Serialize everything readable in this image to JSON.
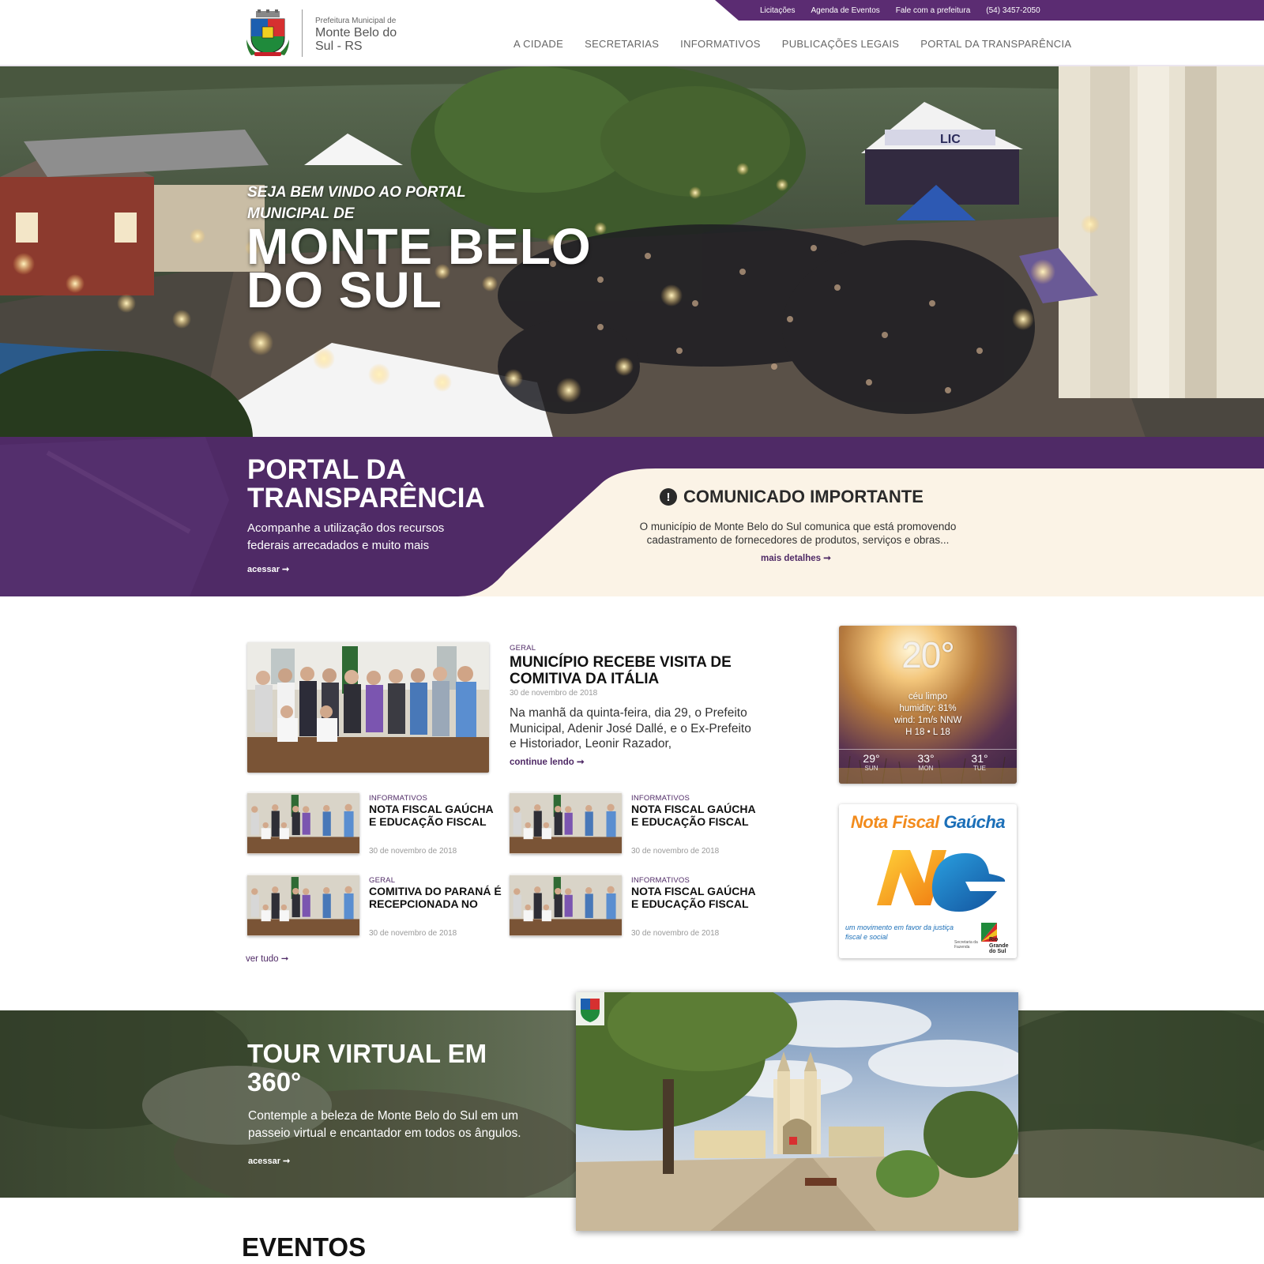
{
  "header": {
    "top_links": [
      "Licitações",
      "Agenda de Eventos",
      "Fale com a prefeitura",
      "(54) 3457-2050"
    ],
    "brand_small": "Prefeitura Municipal de",
    "brand_big": "Monte Belo do Sul - RS",
    "nav": [
      "A CIDADE",
      "SECRETARIAS",
      "INFORMATIVOS",
      "PUBLICAÇÕES LEGAIS",
      "PORTAL DA TRANSPARÊNCIA"
    ]
  },
  "hero": {
    "welcome": "SEJA BEM VINDO AO PORTAL MUNICIPAL DE",
    "city": "MONTE BELO DO SUL",
    "stage_sign": "LIC"
  },
  "transparency": {
    "title": "PORTAL DA TRANSPARÊNCIA",
    "description": "Acompanhe a utilização dos recursos federais arrecadados e muito mais",
    "link": "acessar ➞"
  },
  "notice": {
    "icon": "!",
    "title": "COMUNICADO IMPORTANTE",
    "text": "O município de Monte Belo do Sul comunica que está promovendo cadastramento de fornecedores de produtos, serviços e obras...",
    "link": "mais detalhes ➞"
  },
  "news": {
    "featured": {
      "category": "GERAL",
      "title": "MUNICÍPIO RECEBE VISITA DE COMITIVA DA ITÁLIA",
      "date": "30 de novembro de 2018",
      "excerpt": "Na manhã da quinta-feira, dia 29, o Prefeito Municipal, Adenir José Dallé, e o Ex-Prefeito e Historiador, Leonir Razador,",
      "link": "continue lendo ➞"
    },
    "items": [
      {
        "category": "INFORMATIVOS",
        "title": "NOTA FISCAL GAÚCHA E EDUCAÇÃO FISCAL",
        "date": "30 de novembro de 2018"
      },
      {
        "category": "INFORMATIVOS",
        "title": "NOTA FISCAL GAÚCHA E EDUCAÇÃO FISCAL",
        "date": "30 de novembro de 2018"
      },
      {
        "category": "GERAL",
        "title": "COMITIVA DO PARANÁ É RECEPCIONADA NO",
        "date": "30 de novembro de 2018"
      },
      {
        "category": "INFORMATIVOS",
        "title": "NOTA FISCAL GAÚCHA E EDUCAÇÃO FISCAL",
        "date": "30 de novembro de 2018"
      }
    ],
    "see_all": "ver tudo ➞"
  },
  "weather": {
    "temp": "20°",
    "condition": "céu limpo",
    "humidity": "humidity: 81%",
    "wind": "wind: 1m/s NNW",
    "hilo": "H 18 • L 18",
    "forecast": [
      {
        "temp": "29°",
        "day": "SUN"
      },
      {
        "temp": "33°",
        "day": "MON"
      },
      {
        "temp": "31°",
        "day": "TUE"
      }
    ]
  },
  "nfg": {
    "title_a": "Nota Fiscal",
    "title_b": "Gaúcha",
    "slogan": "um movimento em favor da justiça fiscal e social",
    "secretaria": "Secretaria da Fazenda",
    "state": "Rio Grande do Sul"
  },
  "tour": {
    "title": "TOUR VIRTUAL EM 360°",
    "description": "Contemple a beleza de Monte Belo do Sul  em um passeio virtual e encantador em todos os ângulos.",
    "link": "acessar ➞"
  },
  "events": {
    "title": "EVENTOS"
  },
  "colors": {
    "brand_purple": "#4f2a66",
    "topbar_purple": "#5b2c72",
    "cream": "#fbf3e6"
  }
}
